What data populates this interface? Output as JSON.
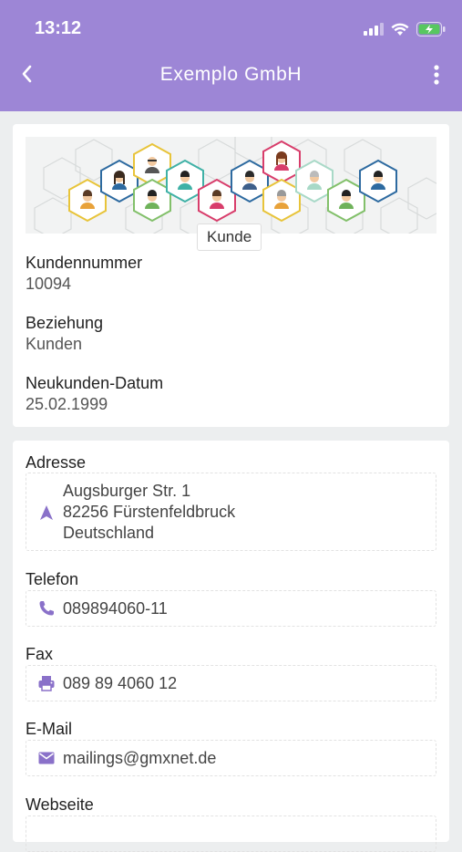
{
  "status_bar": {
    "time": "13:12",
    "icons": [
      "signal-icon",
      "wifi-icon",
      "battery-charging-icon"
    ]
  },
  "nav": {
    "title": "Exemplo GmbH",
    "back_icon": "chevron-left-icon",
    "more_icon": "more-vertical-icon"
  },
  "colors": {
    "accent": "#9d86d6",
    "icon": "#8a71c9",
    "background": "#eceeef"
  },
  "profile": {
    "hero_badge": "Kunde",
    "fields": [
      {
        "label": "Kundennummer",
        "value": "10094"
      },
      {
        "label": "Beziehung",
        "value": "Kunden"
      },
      {
        "label": "Neukunden-Datum",
        "value": "25.02.1999"
      }
    ]
  },
  "contact": {
    "address": {
      "label": "Adresse",
      "icon": "navigation-arrow-icon",
      "lines": [
        "Augsburger Str. 1",
        "82256 Fürstenfeldbruck",
        "Deutschland"
      ]
    },
    "phone": {
      "label": "Telefon",
      "icon": "phone-icon",
      "value": "089894060-11"
    },
    "fax": {
      "label": "Fax",
      "icon": "printer-icon",
      "value": "089 89 4060 12"
    },
    "email": {
      "label": "E-Mail",
      "icon": "mail-icon",
      "value": "mailings@gmxnet.de"
    },
    "website": {
      "label": "Webseite"
    }
  }
}
